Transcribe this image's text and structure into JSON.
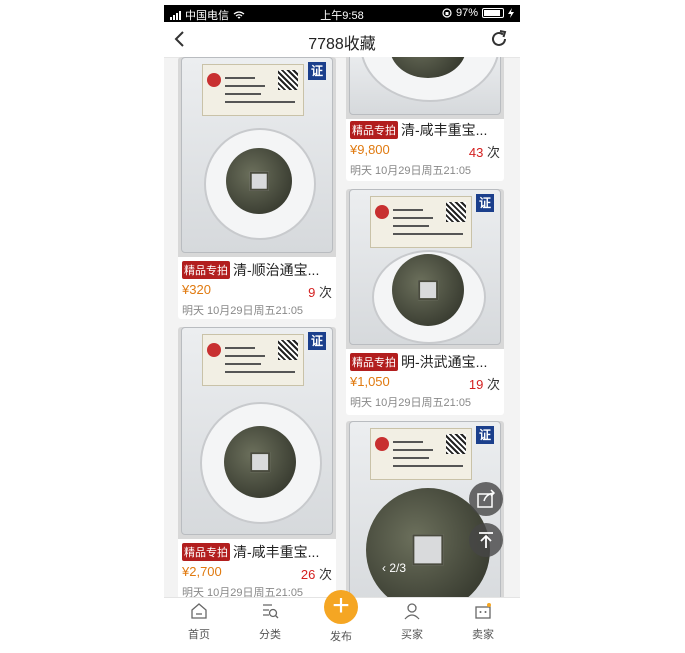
{
  "status_bar": {
    "carrier": "中国电信",
    "time": "上午9:58",
    "battery": "97%"
  },
  "nav": {
    "title": "7788收藏"
  },
  "items": [
    {
      "tag": "精品专拍",
      "name": "清-顺治通宝...",
      "price": "¥320",
      "count": "9",
      "unit": "次",
      "time": "明天 10月29日周五21:05"
    },
    {
      "tag": "精品专拍",
      "name": "清-咸丰重宝...",
      "price": "¥2,700",
      "count": "26",
      "unit": "次",
      "time": "明天 10月29日周五21:05"
    },
    {
      "tag": "精品专拍",
      "name": "清-咸丰重宝...",
      "price": "¥9,800",
      "count": "43",
      "unit": "次",
      "time": "明天 10月29日周五21:05"
    },
    {
      "tag": "精品专拍",
      "name": "明-洪武通宝...",
      "price": "¥1,050",
      "count": "19",
      "unit": "次",
      "time": "明天 10月29日周五21:05"
    }
  ],
  "cert_badge": "证",
  "pager": "2/3",
  "tabbar": {
    "home": "首页",
    "category": "分类",
    "publish": "发布",
    "buyer": "买家",
    "seller": "卖家"
  },
  "colors": {
    "tag_bg": "#b21e1e",
    "price": "#e07a10",
    "count": "#d41f1f",
    "publish": "#f5a623"
  }
}
